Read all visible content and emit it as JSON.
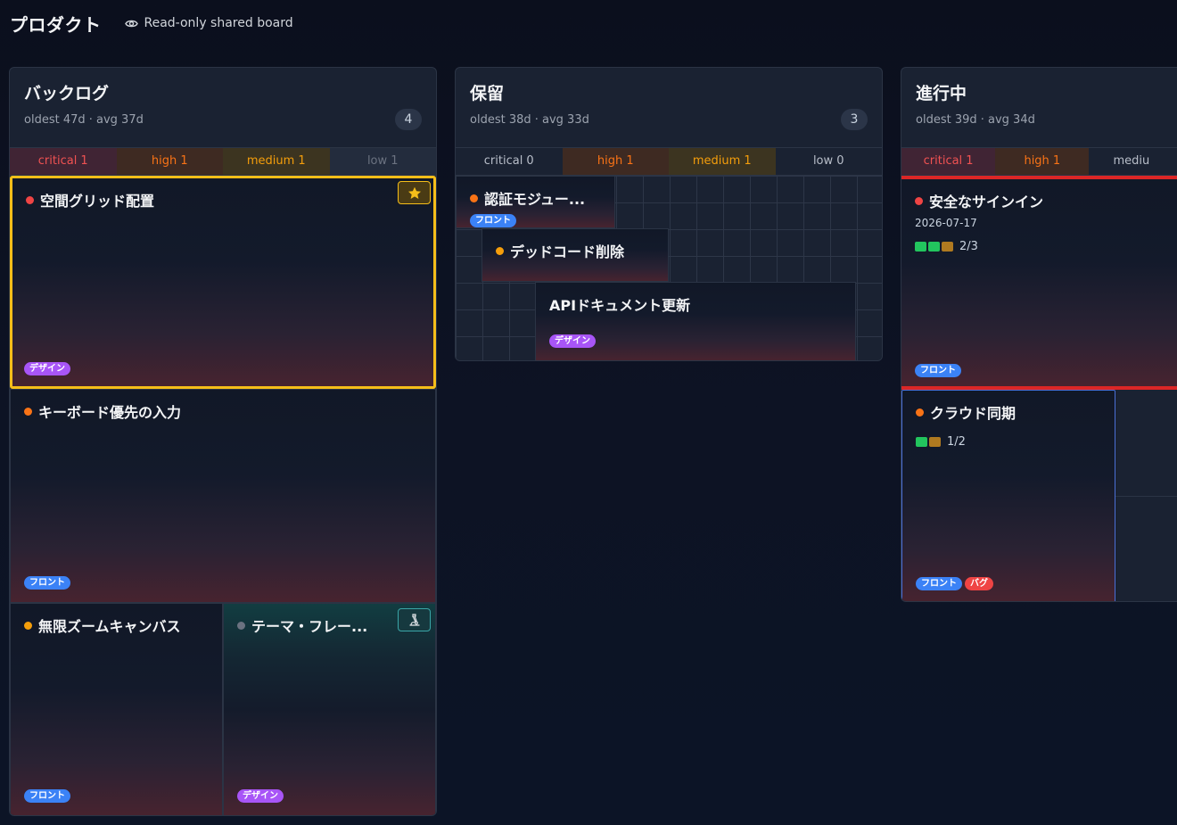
{
  "board": {
    "title": "プロダクト",
    "readonly_label": "Read-only shared board"
  },
  "icons": {
    "eye": "eye-icon",
    "star": "star-icon",
    "lab": "microscope-icon"
  },
  "colors": {
    "selected_border": "#f6be19",
    "critical": "#ef4444",
    "high": "#f97316",
    "medium": "#f59e0b",
    "tag_front": "#3b82f6",
    "tag_design": "#a855f7",
    "tag_bug": "#ef4444",
    "progress_done": "#22c55e",
    "progress_pending": "#b07a20"
  },
  "columns": [
    {
      "title": "バックログ",
      "meta": "oldest 47d · avg 37d",
      "count": "4",
      "priorities": [
        "critical 1",
        "high 1",
        "medium 1",
        "low 1"
      ],
      "cards": [
        {
          "title": "空間グリッド配置",
          "tags": [
            "デザイン"
          ],
          "priority": "critical",
          "starred": true,
          "selected": true
        },
        {
          "title": "キーボード優先の入力",
          "tags": [
            "フロント"
          ],
          "priority": "high"
        },
        {
          "title": "無限ズームキャンバス",
          "tags": [
            "フロント"
          ],
          "priority": "medium"
        },
        {
          "title": "テーマ・フレー...",
          "tags": [
            "デザイン"
          ],
          "priority": "low",
          "lab": true
        }
      ]
    },
    {
      "title": "保留",
      "meta": "oldest 38d · avg 33d",
      "count": "3",
      "priorities": [
        "critical 0",
        "high 1",
        "medium 1",
        "low 0"
      ],
      "cards": [
        {
          "title": "認証モジュー...",
          "tags": [
            "フロント"
          ],
          "priority": "high"
        },
        {
          "title": "デッドコード削除",
          "priority": "medium"
        },
        {
          "title": "APIドキュメント更新",
          "tags": [
            "デザイン"
          ]
        }
      ]
    },
    {
      "title": "進行中",
      "meta": "oldest 39d · avg 34d",
      "priorities": [
        "critical 1",
        "high 1",
        "mediu"
      ],
      "cards": [
        {
          "title": "安全なサインイン",
          "date": "2026-07-17",
          "progress": "2/3",
          "progress_done": 2,
          "progress_total": 3,
          "tags": [
            "フロント"
          ],
          "priority": "critical"
        },
        {
          "title": "クラウド同期",
          "progress": "1/2",
          "progress_done": 1,
          "progress_total": 2,
          "tags": [
            "フロント",
            "バグ"
          ],
          "priority": "high"
        }
      ]
    }
  ]
}
